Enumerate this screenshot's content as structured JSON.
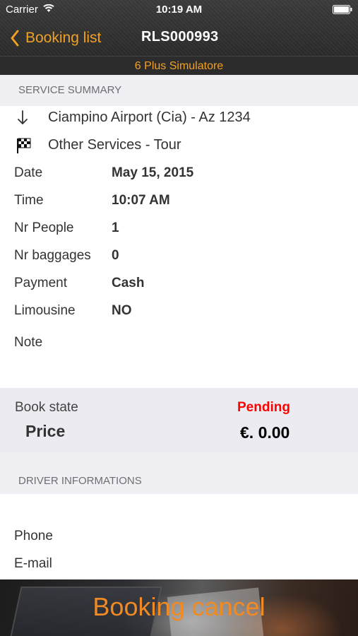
{
  "status_bar": {
    "carrier": "Carrier",
    "time": "10:19 AM"
  },
  "nav": {
    "back_label": "Booking list",
    "title": "RLS000993",
    "subtitle": "6 Plus Simulatore"
  },
  "summary": {
    "header": "SERVICE SUMMARY",
    "services": [
      {
        "icon": "arrow-down-icon",
        "text": "Ciampino Airport (Cia) - Az 1234"
      },
      {
        "icon": "checkered-flag-icon",
        "text": "Other Services - Tour"
      }
    ],
    "fields": [
      {
        "label": "Date",
        "value": "May 15, 2015"
      },
      {
        "label": "Time",
        "value": "10:07 AM"
      },
      {
        "label": "Nr People",
        "value": "1"
      },
      {
        "label": "Nr baggages",
        "value": "0"
      },
      {
        "label": "Payment",
        "value": "Cash"
      },
      {
        "label": "Limousine",
        "value": "NO"
      },
      {
        "label": "Note",
        "value": ""
      }
    ]
  },
  "state": {
    "label": "Book state",
    "value": "Pending",
    "value_color": "#ff0000",
    "price_label": "Price",
    "price_value": "€. 0.00"
  },
  "driver": {
    "header": "DRIVER INFORMATIONS",
    "fields": [
      {
        "label": "Phone",
        "value": ""
      },
      {
        "label": "E-mail",
        "value": ""
      }
    ]
  },
  "action": {
    "cancel_label": "Booking cancel"
  },
  "colors": {
    "accent": "#f0a125",
    "cancel_text": "#f08a24",
    "pending": "#ff0000"
  }
}
